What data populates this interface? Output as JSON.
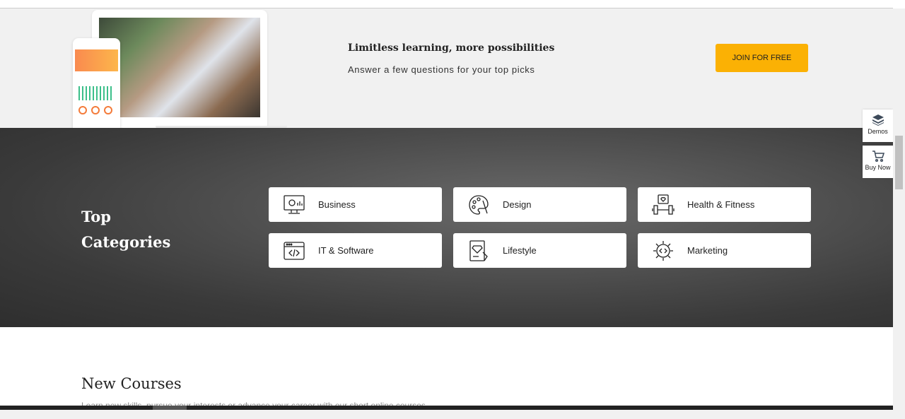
{
  "promo": {
    "title": "Limitless learning, more possibilities",
    "subtitle": "Answer a few questions for your top picks",
    "join_label": "JOIN FOR FREE"
  },
  "categories": {
    "title": "Top Categories",
    "items": [
      {
        "label": "Business",
        "icon": "monitor-gear-icon"
      },
      {
        "label": "Design",
        "icon": "palette-icon"
      },
      {
        "label": "Health & Fitness",
        "icon": "dumbbell-icon"
      },
      {
        "label": "IT & Software",
        "icon": "code-window-icon"
      },
      {
        "label": "Lifestyle",
        "icon": "tablet-diamond-icon"
      },
      {
        "label": "Marketing",
        "icon": "gear-code-icon"
      }
    ]
  },
  "new_courses": {
    "title": "New Courses",
    "subtitle": "Learn new skills, pursue your interests or advance your career with our short online courses."
  },
  "side": {
    "demos": "Demos",
    "buy_now": "Buy Now"
  },
  "colors": {
    "accent": "#fbb104"
  }
}
